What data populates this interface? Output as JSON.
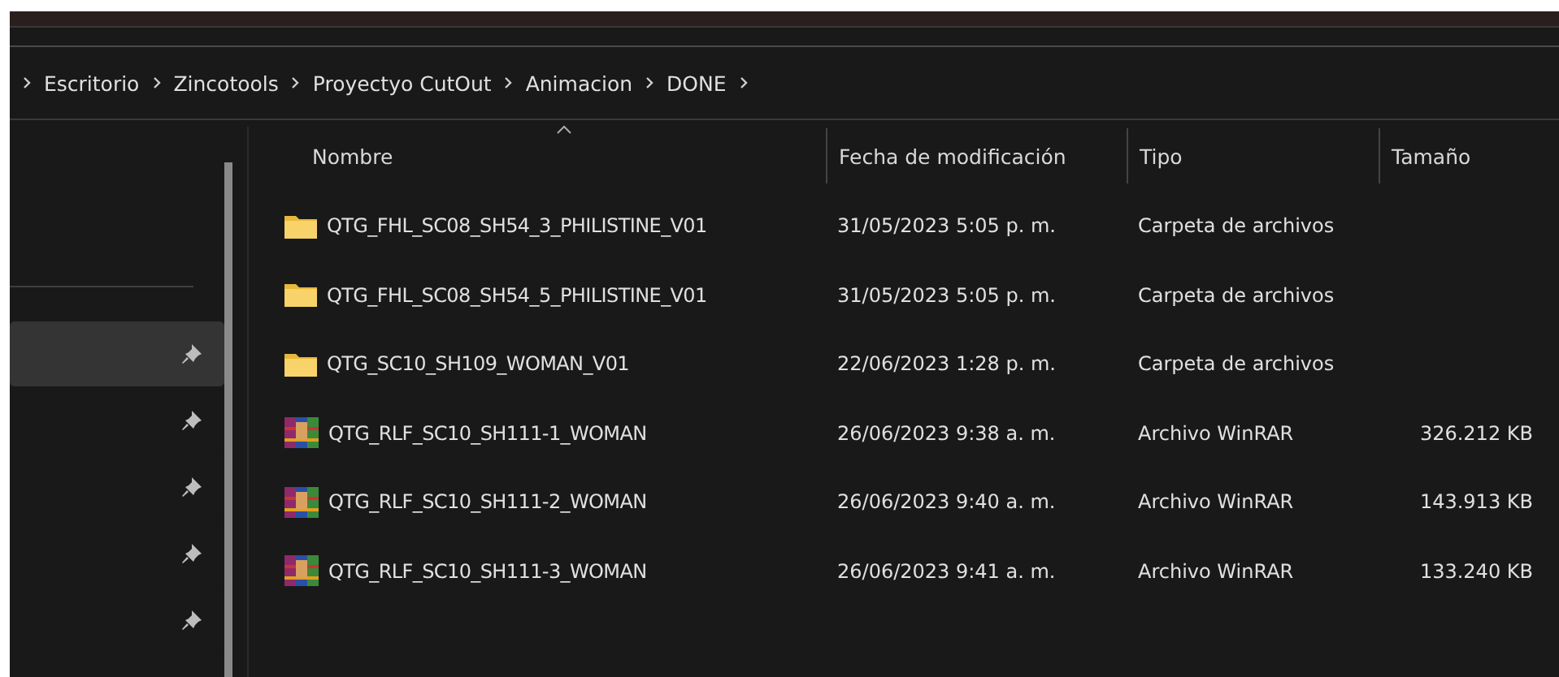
{
  "breadcrumb": [
    "Escritorio",
    "Zincotools",
    "Proyectyo CutOut",
    "Animacion",
    "DONE"
  ],
  "sidebar": {
    "items": [
      {
        "pinned": true,
        "selected": true
      },
      {
        "pinned": true,
        "selected": false
      },
      {
        "pinned": true,
        "selected": false
      },
      {
        "pinned": true,
        "selected": false
      },
      {
        "pinned": true,
        "selected": false
      }
    ]
  },
  "table": {
    "columns": [
      {
        "label": "Nombre",
        "sorted": true
      },
      {
        "label": "Fecha de modificación",
        "sorted": false
      },
      {
        "label": "Tipo",
        "sorted": false
      },
      {
        "label": "Tamaño",
        "sorted": false
      }
    ],
    "rows": [
      {
        "kind": "folder",
        "name": "QTG_FHL_SC08_SH54_3_PHILISTINE_V01",
        "date": "31/05/2023 5:05 p. m.",
        "type": "Carpeta de archivos"
      },
      {
        "kind": "folder",
        "name": "QTG_FHL_SC08_SH54_5_PHILISTINE_V01",
        "date": "31/05/2023 5:05 p. m.",
        "type": "Carpeta de archivos"
      },
      {
        "kind": "folder",
        "name": "QTG_SC10_SH109_WOMAN_V01",
        "date": "22/06/2023 1:28 p. m.",
        "type": "Carpeta de archivos"
      },
      {
        "kind": "archive",
        "name": "QTG_RLF_SC10_SH111-1_WOMAN",
        "date": "26/06/2023 9:38 a. m.",
        "type": "Archivo WinRAR",
        "size": "326.212 KB"
      },
      {
        "kind": "archive",
        "name": "QTG_RLF_SC10_SH111-2_WOMAN",
        "date": "26/06/2023 9:40 a. m.",
        "type": "Archivo WinRAR",
        "size": "143.913 KB"
      },
      {
        "kind": "archive",
        "name": "QTG_RLF_SC10_SH111-3_WOMAN",
        "date": "26/06/2023 9:41 a. m.",
        "type": "Archivo WinRAR",
        "size": "133.240 KB"
      }
    ]
  }
}
